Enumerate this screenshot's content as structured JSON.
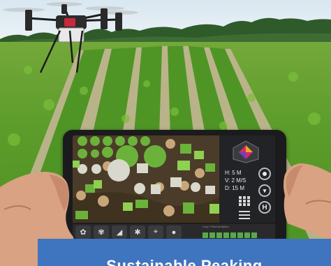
{
  "scene": {
    "subject": "drone-over-cornfield-with-tablet",
    "colors": {
      "sky": "#dfeaf2",
      "crops": "#5b9c2a",
      "soil": "#c9b79a",
      "banner": "#3f74bf"
    }
  },
  "tablet": {
    "telemetry": {
      "height": "H: 5 M",
      "velocity": "V: 2 M/S",
      "distance": "D: 15 M"
    },
    "buttons": {
      "home_label": "H"
    },
    "toolbar": {
      "caption": "Crop / Field Analytics",
      "icons": [
        "plant-icon",
        "tree-icon",
        "chart-icon",
        "bug-icon",
        "location-icon",
        "drop-icon"
      ]
    }
  },
  "banner": {
    "title": "Sustainable Peaking"
  }
}
